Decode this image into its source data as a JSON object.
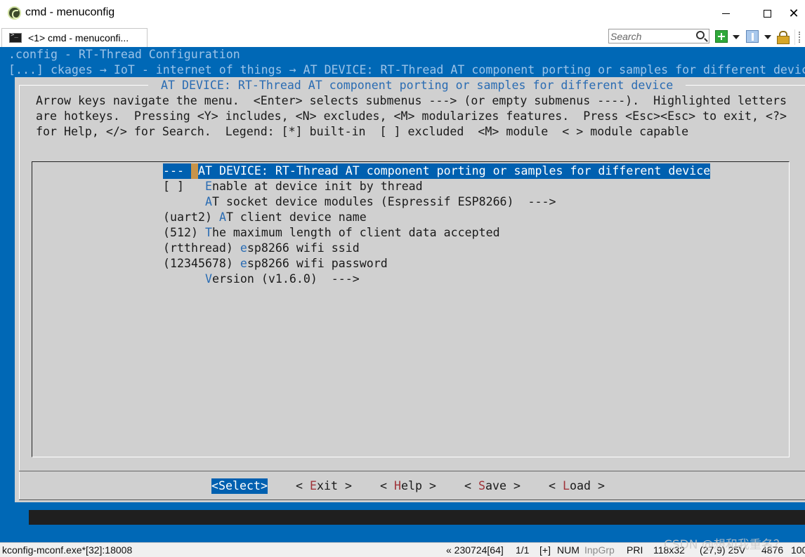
{
  "window": {
    "title": "cmd - menuconfig",
    "icon": "conemu-app-icon",
    "close_glyph": "✕"
  },
  "tabbar": {
    "tab_label": "<1> cmd - menuconfi...",
    "search_placeholder": "Search",
    "icons": [
      "terminal-icon",
      "search-icon",
      "add-console-icon",
      "panel-icon",
      "lock-icon"
    ]
  },
  "terminal": {
    "config_line": ".config - RT-Thread Configuration",
    "breadcrumb": "[...] ckages → IoT - internet of things → AT DEVICE: RT-Thread AT component porting or samples for different device",
    "background_color": "#0068b6",
    "dialog": {
      "title": " AT DEVICE: RT-Thread AT component porting or samples for different device ",
      "help_lines": [
        "Arrow keys navigate the menu.  <Enter> selects submenus ---> (or empty submenus ----).  Highlighted letters",
        "are hotkeys.  Pressing <Y> includes, <N> excludes, <M> modularizes features.  Press <Esc><Esc> to exit, <?>",
        "for Help, </> for Search.  Legend: [*] built-in  [ ] excluded  <M> module  < > module capable"
      ],
      "menu_items": [
        {
          "prefix": "--- ",
          "hotkey": "A",
          "rest": "T DEVICE: RT-Thread AT component porting or samples for different device",
          "selected": true
        },
        {
          "prefix": "[ ]   ",
          "hotkey": "E",
          "rest": "nable at device init by thread",
          "selected": false
        },
        {
          "prefix": "      ",
          "hotkey": "A",
          "rest": "T socket device modules (Espressif ESP8266)  --->",
          "selected": false
        },
        {
          "prefix": "(uart2) ",
          "hotkey": "A",
          "rest": "T client device name",
          "selected": false
        },
        {
          "prefix": "(512) ",
          "hotkey": "T",
          "rest": "he maximum length of client data accepted",
          "selected": false
        },
        {
          "prefix": "(rtthread) ",
          "hotkey": "e",
          "rest": "sp8266 wifi ssid",
          "selected": false
        },
        {
          "prefix": "(12345678) ",
          "hotkey": "e",
          "rest": "sp8266 wifi password",
          "selected": false
        },
        {
          "prefix": "      ",
          "hotkey": "V",
          "rest": "ersion (v1.6.0)  --->",
          "selected": false
        }
      ],
      "buttons": [
        {
          "pre": "<",
          "hotkey": "S",
          "post": "elect>",
          "active": true
        },
        {
          "pre": "< ",
          "hotkey": "E",
          "post": "xit >",
          "active": false
        },
        {
          "pre": "< ",
          "hotkey": "H",
          "post": "elp >",
          "active": false
        },
        {
          "pre": "< ",
          "hotkey": "S",
          "post": "ave >",
          "active": false
        },
        {
          "pre": "< ",
          "hotkey": "L",
          "post": "oad >",
          "active": false
        }
      ]
    }
  },
  "statusbar": {
    "process": "kconfig-mconf.exe*[32]:18008",
    "position": "« 230724[64]",
    "page": "1/1",
    "ins": "[+]",
    "num": "NUM",
    "inpgrp": "InpGrp",
    "pri": "PRI",
    "size": "118x32",
    "cursor": "(27,9) 25V",
    "count": "4876",
    "zoom": "100"
  },
  "watermark": "CSDN @想和我重名？"
}
